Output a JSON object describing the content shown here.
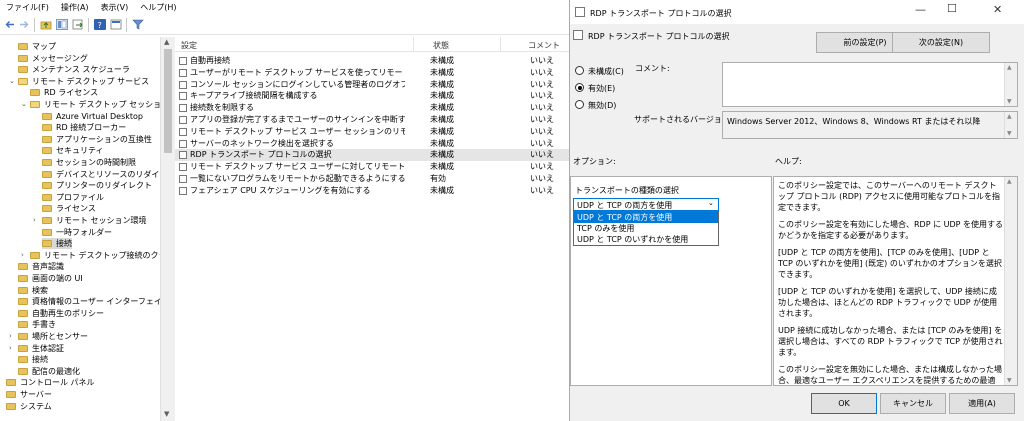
{
  "menu": [
    "ファイル(F)",
    "操作(A)",
    "表示(V)",
    "ヘルプ(H)"
  ],
  "tree": [
    {
      "label": "マップ",
      "indent": 1,
      "expand": ""
    },
    {
      "label": "メッセージング",
      "indent": 1,
      "expand": ""
    },
    {
      "label": "メンテナンス スケジューラ",
      "indent": 1,
      "expand": ""
    },
    {
      "label": "リモート デスクトップ サービス",
      "indent": 1,
      "expand": "v"
    },
    {
      "label": "RD ライセンス",
      "indent": 2,
      "expand": ""
    },
    {
      "label": "リモート デスクトップ セッション ホスト",
      "indent": 2,
      "expand": "v"
    },
    {
      "label": "Azure Virtual Desktop",
      "indent": 3,
      "expand": ""
    },
    {
      "label": "RD 接続ブローカー",
      "indent": 3,
      "expand": ""
    },
    {
      "label": "アプリケーションの互換性",
      "indent": 3,
      "expand": ""
    },
    {
      "label": "セキュリティ",
      "indent": 3,
      "expand": ""
    },
    {
      "label": "セッションの時間制限",
      "indent": 3,
      "expand": ""
    },
    {
      "label": "デバイスとリソースのリダイレクト",
      "indent": 3,
      "expand": ""
    },
    {
      "label": "プリンターのリダイレクト",
      "indent": 3,
      "expand": ""
    },
    {
      "label": "プロファイル",
      "indent": 3,
      "expand": ""
    },
    {
      "label": "ライセンス",
      "indent": 3,
      "expand": ""
    },
    {
      "label": "リモート セッション環境",
      "indent": 3,
      "expand": ">"
    },
    {
      "label": "一時フォルダー",
      "indent": 3,
      "expand": ""
    },
    {
      "label": "接続",
      "indent": 3,
      "expand": "",
      "selected": true
    },
    {
      "label": "リモート デスクトップ接続のクライアント",
      "indent": 2,
      "expand": ">"
    },
    {
      "label": "音声認識",
      "indent": 1,
      "expand": ""
    },
    {
      "label": "画面の端の UI",
      "indent": 1,
      "expand": ""
    },
    {
      "label": "検索",
      "indent": 1,
      "expand": ""
    },
    {
      "label": "資格情報のユーザー インターフェイス",
      "indent": 1,
      "expand": ""
    },
    {
      "label": "自動再生のポリシー",
      "indent": 1,
      "expand": ""
    },
    {
      "label": "手書き",
      "indent": 1,
      "expand": ""
    },
    {
      "label": "場所とセンサー",
      "indent": 1,
      "expand": ">"
    },
    {
      "label": "生体認証",
      "indent": 1,
      "expand": ">"
    },
    {
      "label": "接続",
      "indent": 1,
      "expand": ""
    },
    {
      "label": "配信の最適化",
      "indent": 1,
      "expand": ""
    },
    {
      "label": "コントロール パネル",
      "indent": 0,
      "expand": ""
    },
    {
      "label": "サーバー",
      "indent": 0,
      "expand": ""
    },
    {
      "label": "システム",
      "indent": 0,
      "expand": ""
    }
  ],
  "list": {
    "headers": {
      "name": "設定",
      "state": "状態",
      "comment": "コメント"
    },
    "rows": [
      {
        "name": "自動再接続",
        "state": "未構成",
        "comment": "いいえ"
      },
      {
        "name": "ユーザーがリモート デスクトップ サービスを使ってリモート接続することを...",
        "state": "未構成",
        "comment": "いいえ"
      },
      {
        "name": "コンソール セッションにログインしている管理者のログオフを拒否する",
        "state": "未構成",
        "comment": "いいえ"
      },
      {
        "name": "キープアライブ接続間隔を構成する",
        "state": "未構成",
        "comment": "いいえ"
      },
      {
        "name": "接続数を制限する",
        "state": "未構成",
        "comment": "いいえ"
      },
      {
        "name": "アプリの登録が完了するまでユーザーのサインインを中断する",
        "state": "未構成",
        "comment": "いいえ"
      },
      {
        "name": "リモート デスクトップ サービス ユーザー セッションのリモート制御のルール...",
        "state": "未構成",
        "comment": "いいえ"
      },
      {
        "name": "サーバーのネットワーク検出を選択する",
        "state": "未構成",
        "comment": "いいえ"
      },
      {
        "name": "RDP トランスポート プロトコルの選択",
        "state": "未構成",
        "comment": "いいえ",
        "highlight": true
      },
      {
        "name": "リモート デスクトップ サービス ユーザーに対してリモート デスクトップ サ...",
        "state": "未構成",
        "comment": "いいえ"
      },
      {
        "name": "一覧にないプログラムをリモートから起動できるようにする",
        "state": "有効",
        "comment": "いいえ"
      },
      {
        "name": "フェアシェア CPU スケジューリングを有効にする",
        "state": "未構成",
        "comment": "いいえ"
      }
    ]
  },
  "dialog": {
    "title": "RDP トランスポート プロトコルの選択",
    "setting_name": "RDP トランスポート プロトコルの選択",
    "prev_button": "前の設定(P)",
    "next_button": "次の設定(N)",
    "radio": [
      {
        "label": "未構成(C)",
        "checked": false
      },
      {
        "label": "有効(E)",
        "checked": true
      },
      {
        "label": "無効(D)",
        "checked": false
      }
    ],
    "comment_label": "コメント:",
    "supported_label": "サポートされるバージョン:",
    "supported_value": "Windows Server 2012、Windows 8、Windows RT またはそれ以降",
    "options_label": "オプション:",
    "help_label": "ヘルプ:",
    "transport_label": "トランスポートの種類の選択",
    "select_value": "UDP と TCP の両方を使用",
    "select_options": [
      "UDP と TCP の両方を使用",
      "TCP のみを使用",
      "UDP と TCP のいずれかを使用"
    ],
    "help": [
      "このポリシー設定では、このサーバーへのリモート デスクトップ プロトコル (RDP) アクセスに使用可能なプロトコルを指定できます。",
      "このポリシー設定を有効にした場合、RDP に UDP を使用するかどうかを指定する必要があります。",
      "[UDP と TCP の両方を使用]、[TCP のみを使用]、[UDP と TCP のいずれかを使用] (既定) のいずれかのオプションを選択できます。",
      "[UDP と TCP のいずれかを使用] を選択して、UDP 接続に成功した場合は、ほとんどの RDP トラフィックで UDP が使用されます。",
      "UDP 接続に成功しなかった場合、または [TCP のみを使用] を選択し場合は、すべての RDP トラフィックで TCP が使用されます。",
      "このポリシー設定を無効にした場合、または構成しなかった場合、最適なユーザー エクスペリエンスを提供するための最適なプロトコルが RDP で選択されます。"
    ],
    "ok_button": "OK",
    "cancel_button": "キャンセル",
    "apply_button": "適用(A)"
  }
}
